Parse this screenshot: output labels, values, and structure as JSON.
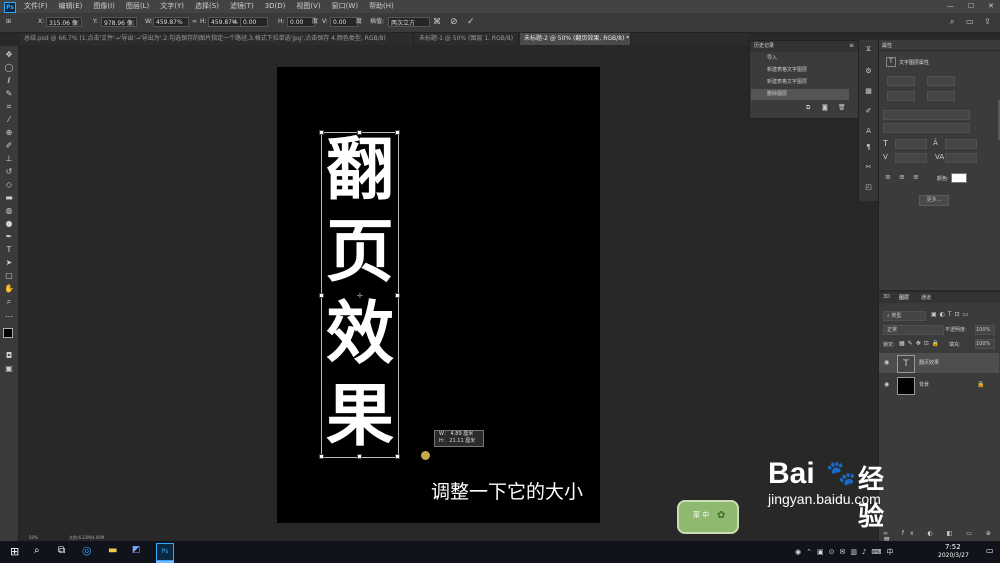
{
  "menu": {
    "app_icon": "Ps",
    "items": [
      "文件(F)",
      "编辑(E)",
      "图像(I)",
      "图层(L)",
      "文字(Y)",
      "选择(S)",
      "滤镜(T)",
      "3D(D)",
      "视图(V)",
      "窗口(W)",
      "帮助(H)"
    ]
  },
  "options": {
    "x_label": "X:",
    "x_value": "315.06 像素",
    "y_label": "Y:",
    "y_value": "978.96 像素",
    "w_label": "W:",
    "w_value": "459.87%",
    "h_label": "H:",
    "h_value": "459.87%",
    "rot_value": "0.00",
    "hskew_label": "H:",
    "hskew_value": "0.00",
    "deg1": "度",
    "vskew_label": "V:",
    "vskew_value": "0.00",
    "deg2": "度",
    "interp_label": "插值:",
    "interp_value": "两次立方"
  },
  "tabs": [
    "总结.psd @ 66.7% (1.点击'文件'→'导出'→'导出为',2.勾选保存的图片指定一个路径,3.格式下拉单选'jpg',点击保存 4.颜色类型, RGB/8)",
    "未标题-1 @ 50% (图层 1, RGB/8)",
    "未标题-2 @ 50% (翻页效果, RGB/8) *"
  ],
  "document": {
    "text_chars": [
      "翻",
      "页",
      "效",
      "果"
    ],
    "tooltip_w": "W：  4.89 厘米",
    "tooltip_h": "H：  21.11 厘米",
    "caption": "调整一下它的大小"
  },
  "history": {
    "title": "历史记录",
    "rows": [
      "导入",
      "新建表格文字图层",
      "新建表格文字图层",
      "删除图层"
    ]
  },
  "properties": {
    "tab": "属性",
    "title": "文字图层属性",
    "color_label": "颜色:",
    "button": "更多..."
  },
  "layers": {
    "tabs": [
      "3D",
      "图层",
      "通道"
    ],
    "filter_label": "类型",
    "blend_mode": "正常",
    "opacity_label": "不透明度:",
    "opacity_value": "100%",
    "lock_label": "锁定:",
    "fill_label": "填充:",
    "fill_value": "100%",
    "rows": [
      {
        "thumb": "T",
        "name": "翻页效果"
      },
      {
        "thumb": "",
        "name": "背景"
      }
    ]
  },
  "status": {
    "zoom": "50%",
    "doc": "文档:6.22M/4.00M"
  },
  "taskbar": {
    "time": "7:52",
    "date": "2020/3/27"
  },
  "watermark": {
    "brand": "Bai",
    "brand_cn": "经验",
    "url": "jingyan.baidu.com",
    "badge": "菜 中"
  }
}
